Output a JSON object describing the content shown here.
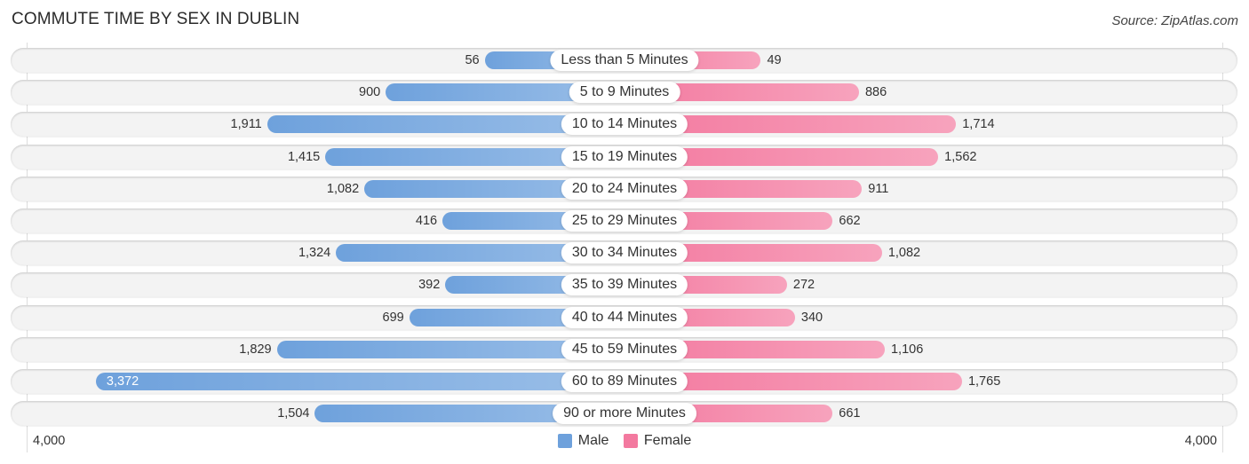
{
  "title": "COMMUTE TIME BY SEX IN DUBLIN",
  "source": "Source: ZipAtlas.com",
  "colors": {
    "male": "#6ea1dc",
    "female": "#f3799f"
  },
  "legend": [
    {
      "label": "Male",
      "color": "#6ea1dc"
    },
    {
      "label": "Female",
      "color": "#f3799f"
    }
  ],
  "axis": {
    "left_tick": "4,000",
    "right_tick": "4,000"
  },
  "chart_data": {
    "type": "bar",
    "orientation": "horizontal-diverging",
    "title": "COMMUTE TIME BY SEX IN DUBLIN",
    "categories": [
      "Less than 5 Minutes",
      "5 to 9 Minutes",
      "10 to 14 Minutes",
      "15 to 19 Minutes",
      "20 to 24 Minutes",
      "25 to 29 Minutes",
      "30 to 34 Minutes",
      "35 to 39 Minutes",
      "40 to 44 Minutes",
      "45 to 59 Minutes",
      "60 to 89 Minutes",
      "90 or more Minutes"
    ],
    "series": [
      {
        "name": "Male",
        "values": [
          56,
          900,
          1911,
          1415,
          1082,
          416,
          1324,
          392,
          699,
          1829,
          3372,
          1504
        ],
        "labels": [
          "56",
          "900",
          "1,911",
          "1,415",
          "1,082",
          "416",
          "1,324",
          "392",
          "699",
          "1,829",
          "3,372",
          "1,504"
        ]
      },
      {
        "name": "Female",
        "values": [
          49,
          886,
          1714,
          1562,
          911,
          662,
          1082,
          272,
          340,
          1106,
          1765,
          661
        ],
        "labels": [
          "49",
          "886",
          "1,714",
          "1,562",
          "911",
          "662",
          "1,082",
          "272",
          "340",
          "1,106",
          "1,765",
          "661"
        ]
      }
    ],
    "xlim": [
      0,
      4000
    ],
    "xtick_labels": [
      "4,000",
      "4,000"
    ],
    "legend_position": "bottom-center",
    "grid": false
  }
}
